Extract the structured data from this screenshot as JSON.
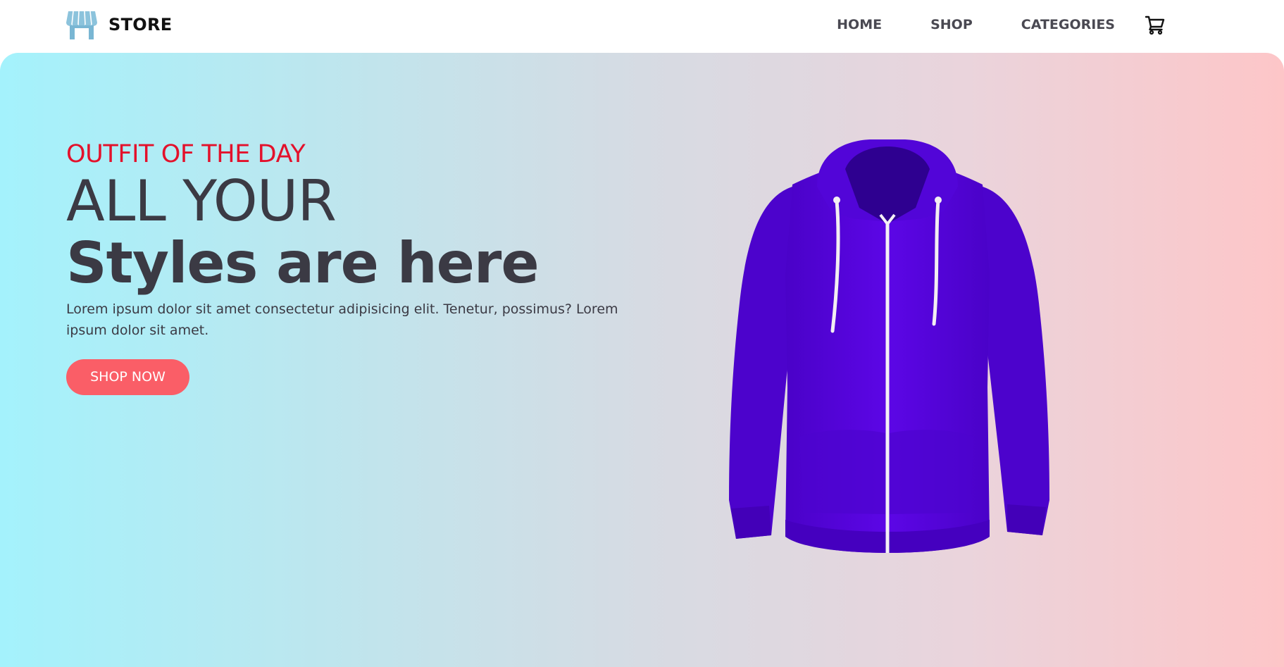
{
  "header": {
    "brand_name": "STORE",
    "brand_icon": "storefront-icon",
    "nav": [
      {
        "label": "HOME"
      },
      {
        "label": "SHOP"
      },
      {
        "label": "CATEGORIES"
      }
    ],
    "cart_icon": "shopping-cart-icon"
  },
  "hero": {
    "eyebrow": "OUTFIT OF THE DAY",
    "title_line1": "ALL YOUR",
    "title_line2": "Styles are here",
    "description": "Lorem ipsum dolor sit amet consectetur adipisicing elit. Tenetur, possimus? Lorem ipsum dolor sit amet.",
    "cta_label": "SHOP NOW",
    "product_image": "purple-hoodie-image"
  },
  "colors": {
    "accent_red": "#e3112b",
    "button": "#fa5e67",
    "gradient_start": "#a4f2fc",
    "gradient_end": "#fdc6c8",
    "hoodie": "#5a05e0",
    "text": "#3b3a44"
  }
}
